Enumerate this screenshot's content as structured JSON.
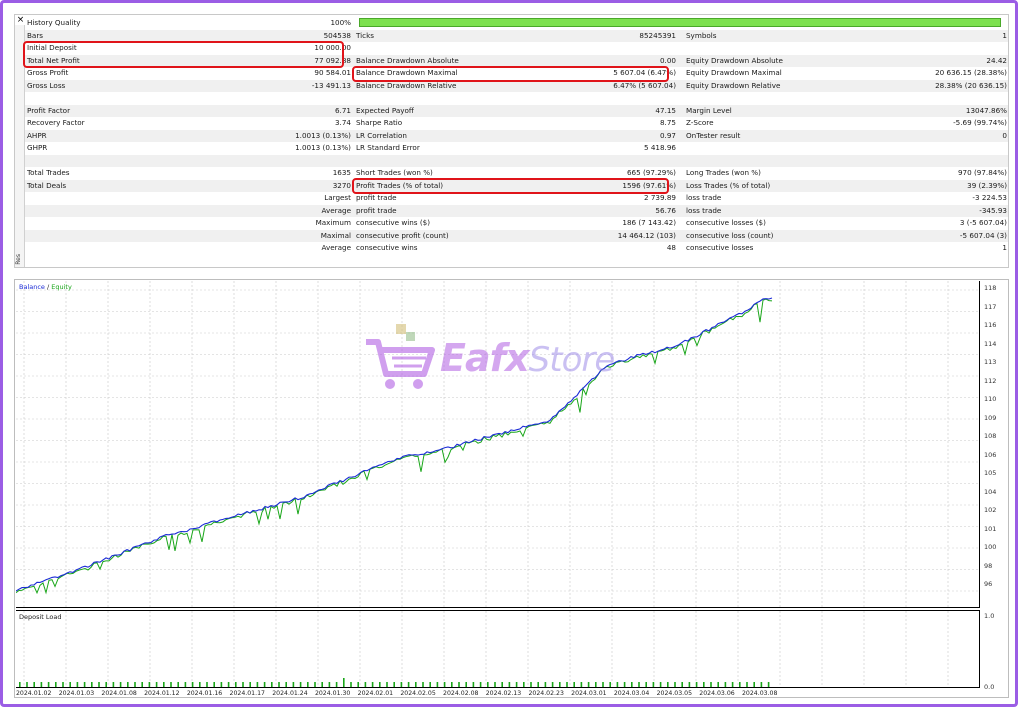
{
  "report": {
    "close_glyph": "×",
    "side_tab": "Res",
    "rows": [
      {
        "l1": "History Quality",
        "v1": "100%",
        "l2": "",
        "v2": "",
        "l3": "",
        "v3": ""
      },
      {
        "l1": "Bars",
        "v1": "504538",
        "l2": "Ticks",
        "v2": "85245391",
        "l3": "Symbols",
        "v3": "1"
      },
      {
        "l1": "Initial Deposit",
        "v1": "10 000.00",
        "l2": "",
        "v2": "",
        "l3": "",
        "v3": ""
      },
      {
        "l1": "Total Net Profit",
        "v1": "77 092.88",
        "l2": "Balance Drawdown Absolute",
        "v2": "0.00",
        "l3": "Equity Drawdown Absolute",
        "v3": "24.42"
      },
      {
        "l1": "Gross Profit",
        "v1": "90 584.01",
        "l2": "Balance Drawdown Maximal",
        "v2": "5 607.04 (6.47%)",
        "l3": "Equity Drawdown Maximal",
        "v3": "20 636.15 (28.38%)"
      },
      {
        "l1": "Gross Loss",
        "v1": "-13 491.13",
        "l2": "Balance Drawdown Relative",
        "v2": "6.47% (5 607.04)",
        "l3": "Equity Drawdown Relative",
        "v3": "28.38% (20 636.15)"
      },
      {
        "l1": "",
        "v1": "",
        "l2": "",
        "v2": "",
        "l3": "",
        "v3": ""
      },
      {
        "l1": "Profit Factor",
        "v1": "6.71",
        "l2": "Expected Payoff",
        "v2": "47.15",
        "l3": "Margin Level",
        "v3": "13047.86%"
      },
      {
        "l1": "Recovery Factor",
        "v1": "3.74",
        "l2": "Sharpe Ratio",
        "v2": "8.75",
        "l3": "Z-Score",
        "v3": "-5.69 (99.74%)"
      },
      {
        "l1": "AHPR",
        "v1": "1.0013 (0.13%)",
        "l2": "LR Correlation",
        "v2": "0.97",
        "l3": "OnTester result",
        "v3": "0"
      },
      {
        "l1": "GHPR",
        "v1": "1.0013 (0.13%)",
        "l2": "LR Standard Error",
        "v2": "5 418.96",
        "l3": "",
        "v3": ""
      },
      {
        "l1": "",
        "v1": "",
        "l2": "",
        "v2": "",
        "l3": "",
        "v3": ""
      },
      {
        "l1": "Total Trades",
        "v1": "1635",
        "l2": "Short Trades (won %)",
        "v2": "665 (97.29%)",
        "l3": "Long Trades (won %)",
        "v3": "970 (97.84%)"
      },
      {
        "l1": "Total Deals",
        "v1": "3270",
        "l2": "Profit Trades (% of total)",
        "v2": "1596 (97.61%)",
        "l3": "Loss Trades (% of total)",
        "v3": "39 (2.39%)"
      },
      {
        "l1": "",
        "v1": "Largest",
        "l2": "profit trade",
        "v2": "2 739.89",
        "l3": "loss trade",
        "v3": "-3 224.53"
      },
      {
        "l1": "",
        "v1": "Average",
        "l2": "profit trade",
        "v2": "56.76",
        "l3": "loss trade",
        "v3": "-345.93"
      },
      {
        "l1": "",
        "v1": "Maximum",
        "l2": "consecutive wins ($)",
        "v2": "186 (7 143.42)",
        "l3": "consecutive losses ($)",
        "v3": "3 (-5 607.04)"
      },
      {
        "l1": "",
        "v1": "Maximal",
        "l2": "consecutive profit (count)",
        "v2": "14 464.12 (103)",
        "l3": "consecutive loss (count)",
        "v3": "-5 607.04 (3)"
      },
      {
        "l1": "",
        "v1": "Average",
        "l2": "consecutive wins",
        "v2": "48",
        "l3": "consecutive losses",
        "v3": "1"
      }
    ]
  },
  "chart": {
    "legend_balance": "Balance",
    "legend_sep": " / ",
    "legend_equity": "Equity",
    "y_labels": [
      "118",
      "117",
      "116",
      "114",
      "113",
      "112",
      "110",
      "109",
      "108",
      "106",
      "105",
      "104",
      "102",
      "101",
      "100",
      "98",
      "96"
    ],
    "load_title": "Deposit Load",
    "load_y_top": "1.0",
    "load_y_bottom": "0.0",
    "x_labels": [
      "2024.01.02",
      "2024.01.03",
      "2024.01.08",
      "2024.01.12",
      "2024.01.16",
      "2024.01.17",
      "2024.01.24",
      "2024.01.30",
      "2024.02.01",
      "2024.02.05",
      "2024.02.08",
      "2024.02.13",
      "2024.02.23",
      "2024.03.01",
      "2024.03.04",
      "2024.03.05",
      "2024.03.06",
      "2024.03.08"
    ],
    "colors": {
      "balance": "#1b2bd6",
      "equity": "#19a619",
      "load": "#19a619"
    }
  },
  "watermark": {
    "part1": "Eafx",
    "part2": "Store"
  }
}
